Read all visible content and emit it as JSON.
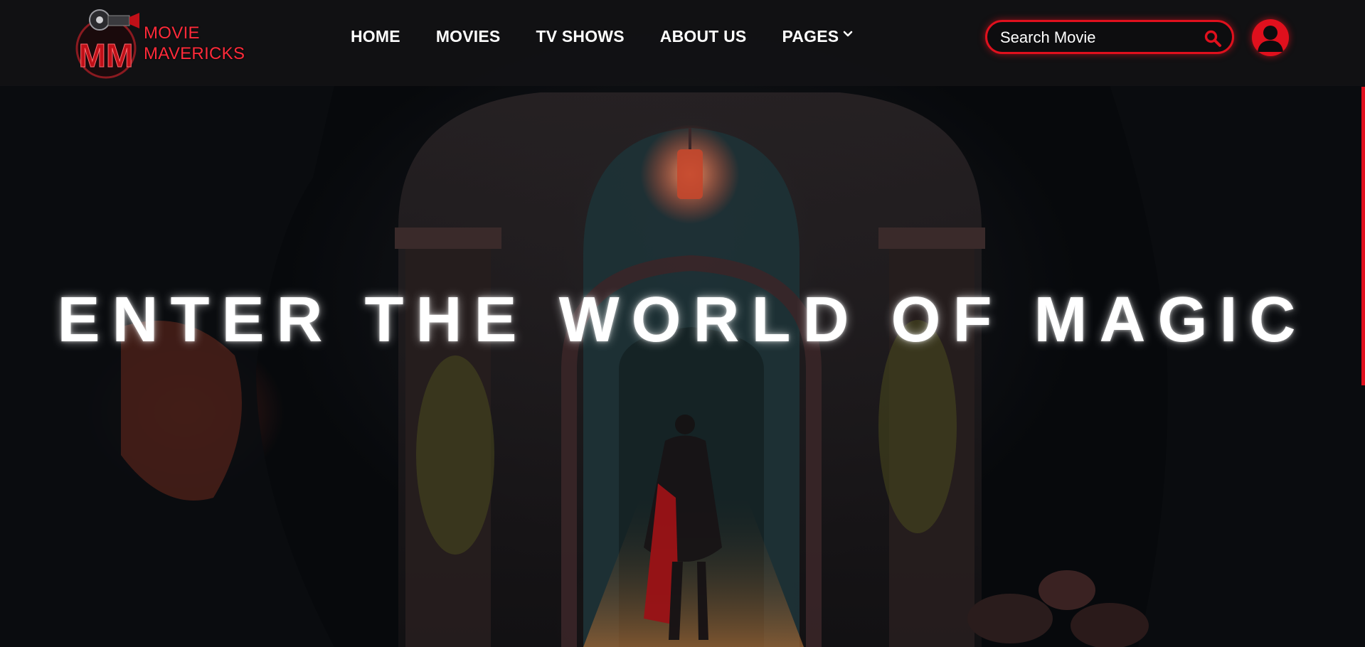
{
  "brand": {
    "logo_monogram": "MM",
    "line1": "MOVIE",
    "line2": "MAVERICKS",
    "color": "#e0101d"
  },
  "nav": {
    "items": [
      {
        "label": "HOME"
      },
      {
        "label": "MOVIES"
      },
      {
        "label": "TV SHOWS"
      },
      {
        "label": "ABOUT US"
      },
      {
        "label": "PAGES"
      }
    ],
    "pages_icon": "chevron-down-icon"
  },
  "search": {
    "placeholder": "Search Movie",
    "icon": "search-icon"
  },
  "user": {
    "icon": "user-avatar-icon"
  },
  "hero": {
    "headline": "ENTER THE WORLD OF MAGIC"
  },
  "colors": {
    "accent": "#e0101d",
    "navbar_bg": "#121214",
    "text": "#ffffff"
  }
}
